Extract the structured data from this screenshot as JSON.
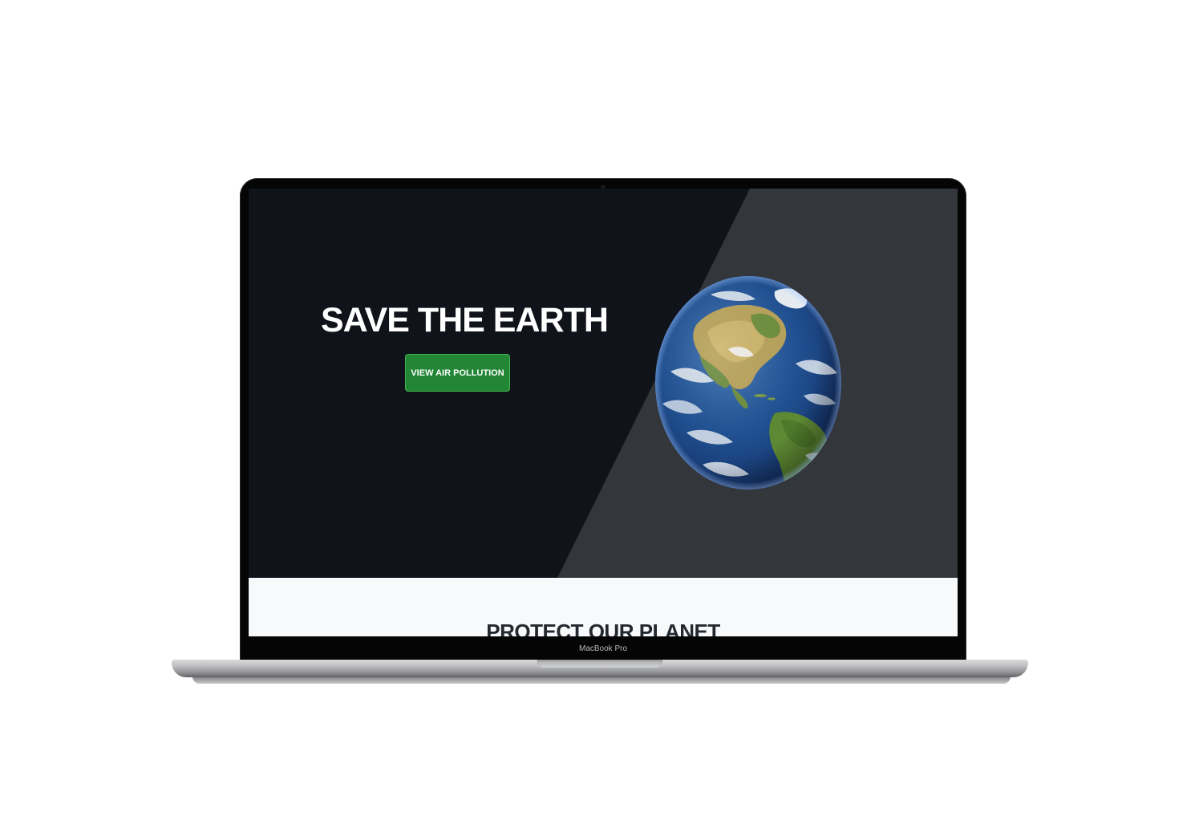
{
  "device": {
    "model_label": "MacBook Pro"
  },
  "hero": {
    "title": "SAVE THE EARTH",
    "button_label": "VIEW AIR POLLUTION"
  },
  "protect_section": {
    "title": "PROTECT OUR PLANET"
  },
  "colors": {
    "hero_background": "#10131a",
    "hero_panel": "#33363b",
    "button_background": "#238636",
    "section_background": "#f8f9fb",
    "section_title": "#24292f"
  }
}
